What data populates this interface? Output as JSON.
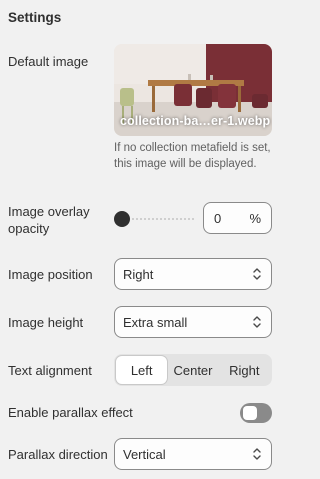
{
  "section": {
    "title": "Settings"
  },
  "default_image": {
    "label": "Default image",
    "filename": "collection-ba…er-1.webp",
    "help": "If no collection metafield is set, this image will be displayed."
  },
  "overlay_opacity": {
    "label": "Image overlay opacity",
    "value": "0",
    "unit": "%",
    "slider_fraction": 0
  },
  "image_position": {
    "label": "Image position",
    "value": "Right"
  },
  "image_height": {
    "label": "Image height",
    "value": "Extra small"
  },
  "text_alignment": {
    "label": "Text alignment",
    "options": [
      "Left",
      "Center",
      "Right"
    ],
    "selected": "Left"
  },
  "parallax": {
    "label": "Enable parallax effect",
    "enabled": false
  },
  "parallax_direction": {
    "label": "Parallax direction",
    "value": "Vertical"
  },
  "colors": {
    "background": "#f1f1f1",
    "text": "#303030",
    "muted_text": "#616161",
    "border": "#8a8a8a",
    "toggle_off": "#8a8a8a"
  }
}
